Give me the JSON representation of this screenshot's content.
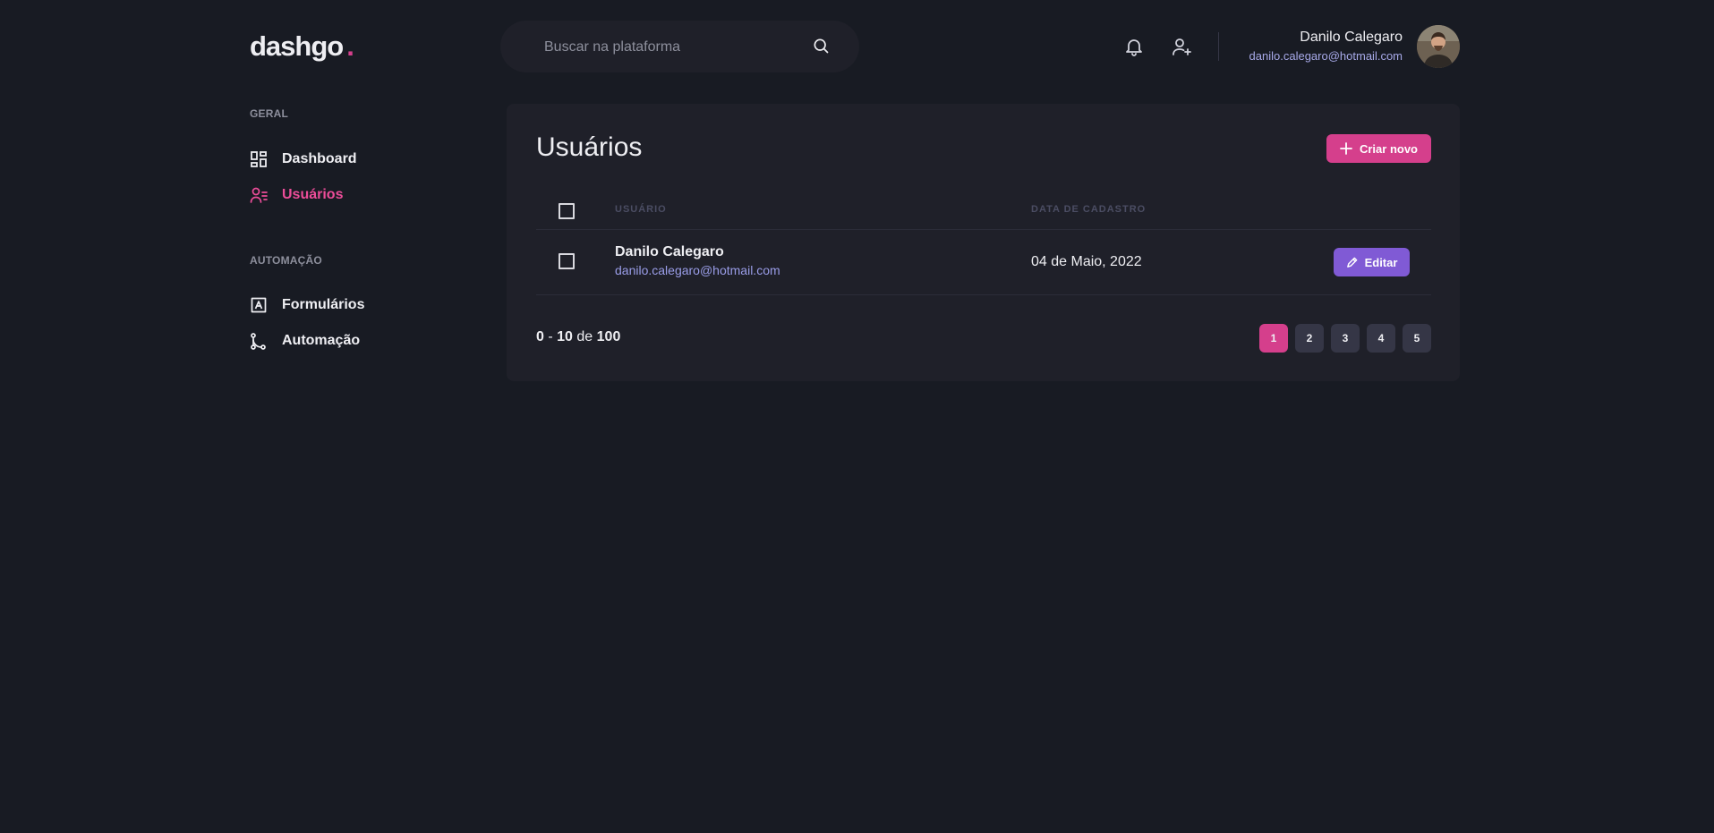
{
  "brand": {
    "name": "dashgo",
    "dot": "."
  },
  "search": {
    "placeholder": "Buscar na plataforma"
  },
  "header": {
    "icons": [
      "bell-icon",
      "user-add-icon",
      "search-icon"
    ]
  },
  "profile": {
    "name": "Danilo Calegaro",
    "email": "danilo.calegaro@hotmail.com"
  },
  "sidebar": {
    "sections": [
      {
        "title": "GERAL",
        "items": [
          {
            "label": "Dashboard",
            "icon": "dashboard-grid-icon",
            "active": false
          },
          {
            "label": "Usuários",
            "icon": "users-list-icon",
            "active": true
          }
        ]
      },
      {
        "title": "AUTOMAÇÃO",
        "items": [
          {
            "label": "Formulários",
            "icon": "form-icon",
            "active": false
          },
          {
            "label": "Automação",
            "icon": "git-branch-icon",
            "active": false
          }
        ]
      }
    ]
  },
  "main": {
    "title": "Usuários",
    "create_button": "Criar novo",
    "table": {
      "headers": [
        "USUÁRIO",
        "DATA DE CADASTRO"
      ],
      "rows": [
        {
          "name": "Danilo Calegaro",
          "email": "danilo.calegaro@hotmail.com",
          "date": "04 de Maio, 2022",
          "edit_label": "Editar"
        }
      ]
    },
    "pagination": {
      "start": "0",
      "sep": "-",
      "end": "10",
      "of": "de",
      "total": "100",
      "pages": [
        "1",
        "2",
        "3",
        "4",
        "5"
      ],
      "current": "1"
    }
  },
  "colors": {
    "background": "#181b23",
    "card": "#1f2029",
    "accent_pink": "#d53f8c",
    "accent_purple": "#805ad5",
    "email_text": "#9a9de8"
  }
}
